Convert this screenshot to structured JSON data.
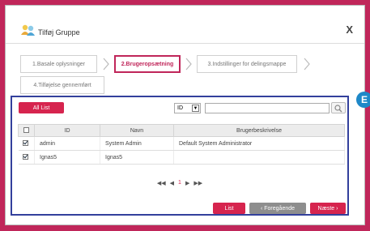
{
  "dialog": {
    "title": "Tilføj Gruppe",
    "close": "X"
  },
  "steps": [
    {
      "label": "1.Basale oplysninger"
    },
    {
      "label": "2.Brugeropsætning"
    },
    {
      "label": "3.Indstillinger for delingsmappe"
    },
    {
      "label": "4.Tilføjelse gennemført"
    }
  ],
  "badge": "E",
  "panel": {
    "all_list": "All List",
    "search_field": "ID",
    "table": {
      "headers": [
        "ID",
        "Navn",
        "Brugerbeskrivelse"
      ],
      "rows": [
        {
          "id": "admin",
          "navn": "System Admin",
          "beskrivelse": "Default System Administrator"
        },
        {
          "id": "Ignas5",
          "navn": "Ignas5",
          "beskrivelse": ""
        }
      ]
    },
    "pager": {
      "first": "◀◀",
      "prev": "◀",
      "page": "1",
      "next": "▶",
      "last": "▶▶"
    },
    "buttons": {
      "list": "List",
      "prev": "‹ Foregående",
      "next": "Næste ›"
    }
  }
}
